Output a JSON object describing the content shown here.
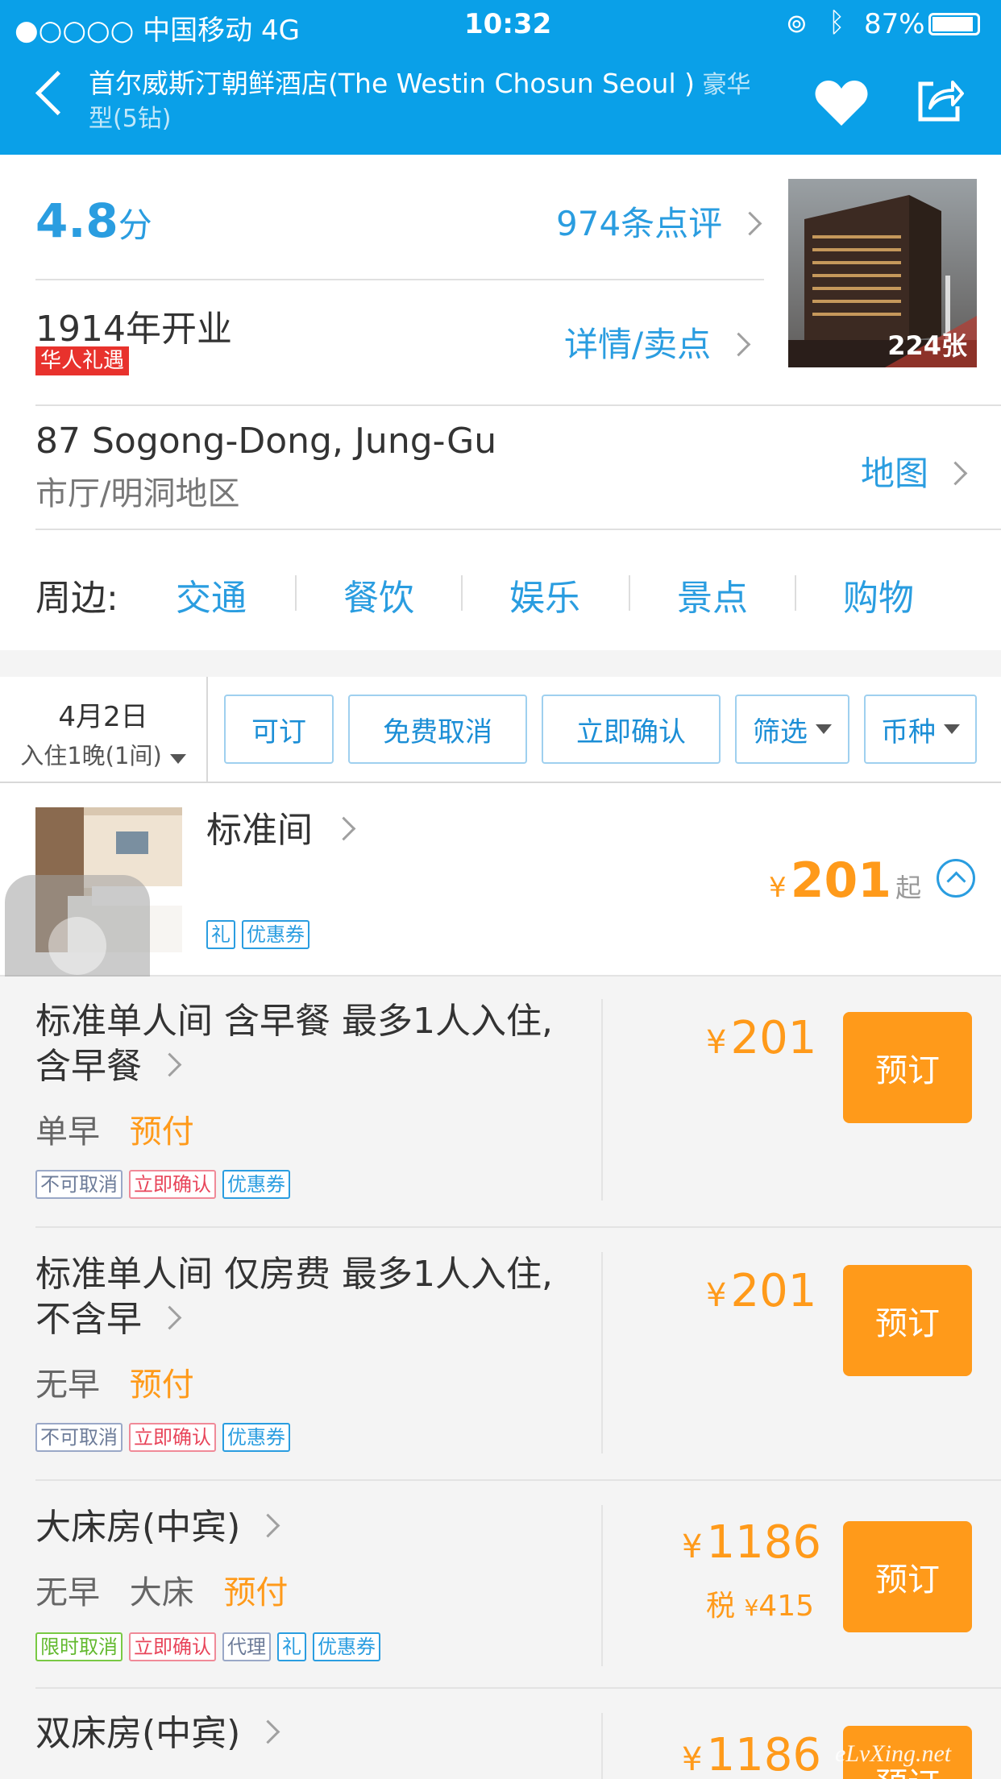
{
  "status": {
    "carrier": "●○○○○ 中国移动   4G",
    "time": "10:32",
    "battery": "87%"
  },
  "nav": {
    "title_main": "首尔威斯汀朝鲜酒店(The Westin Chosun Seoul )",
    "title_suffix": " 豪华",
    "title_line2": "型(5钻)"
  },
  "rating": {
    "score": "4.8",
    "unit": "分",
    "reviews": "974条点评"
  },
  "opened": {
    "year": "1914年开业",
    "badge": "华人礼遇",
    "details": "详情/卖点"
  },
  "photo": {
    "count": "224张"
  },
  "address": {
    "line1": "87 Sogong-Dong, Jung-Gu",
    "line2": "市厅/明洞地区",
    "map": "地图"
  },
  "nearby": {
    "label": "周边:",
    "items": [
      "交通",
      "餐饮",
      "娱乐",
      "景点",
      "购物"
    ]
  },
  "filter": {
    "date": "4月2日",
    "stay": "入住1晚(1间)",
    "buttons": [
      "可订",
      "免费取消",
      "立即确认",
      "筛选",
      "币种"
    ]
  },
  "room": {
    "name": "标准间",
    "tags": [
      "礼",
      "优惠券"
    ],
    "currency": "¥",
    "price": "201",
    "from": "起"
  },
  "rates": [
    {
      "title1": "标准单人间 含早餐 最多1人入住,",
      "title2": "含早餐",
      "breakfast": "单早",
      "pay": "预付",
      "tags": [
        {
          "text": "不可取消",
          "color": "gray"
        },
        {
          "text": "立即确认",
          "color": "red"
        },
        {
          "text": "优惠券",
          "color": "blue"
        }
      ],
      "currency": "¥",
      "price": "201",
      "book": "预订"
    },
    {
      "title1": "标准单人间 仅房费 最多1人入住,",
      "title2": "不含早",
      "breakfast": "无早",
      "pay": "预付",
      "tags": [
        {
          "text": "不可取消",
          "color": "gray"
        },
        {
          "text": "立即确认",
          "color": "red"
        },
        {
          "text": "优惠券",
          "color": "blue"
        }
      ],
      "currency": "¥",
      "price": "201",
      "book": "预订"
    },
    {
      "title1": "大床房(中宾)",
      "breakfast": "无早",
      "bed": "大床",
      "pay": "预付",
      "tags": [
        {
          "text": "限时取消",
          "color": "green"
        },
        {
          "text": "立即确认",
          "color": "red"
        },
        {
          "text": "代理",
          "color": "gray"
        },
        {
          "text": "礼",
          "color": "blue"
        },
        {
          "text": "优惠券",
          "color": "blue"
        }
      ],
      "currency": "¥",
      "price": "1186",
      "tax_label": "税",
      "tax_currency": "¥",
      "tax": "415",
      "book": "预订"
    },
    {
      "title1": "双床房(中宾)",
      "currency": "¥",
      "price": "1186",
      "book": "预订"
    }
  ],
  "watermark": "eLvXing.net"
}
